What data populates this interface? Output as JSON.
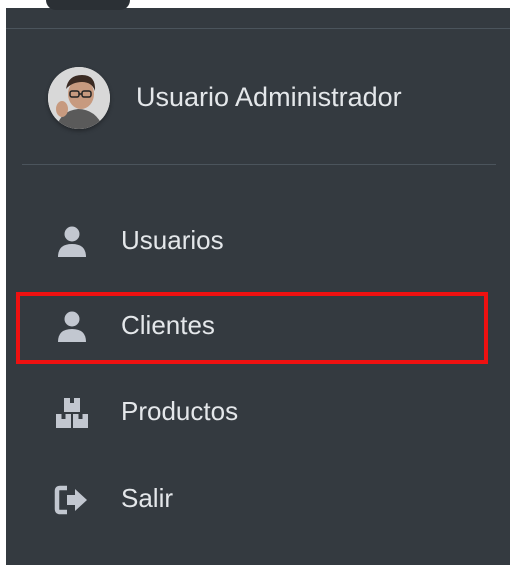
{
  "user": {
    "name": "Usuario Administrador"
  },
  "nav": {
    "items": [
      {
        "label": "Usuarios",
        "icon": "user-icon"
      },
      {
        "label": "Clientes",
        "icon": "user-icon"
      },
      {
        "label": "Productos",
        "icon": "boxes-icon"
      },
      {
        "label": "Salir",
        "icon": "sign-out-icon"
      }
    ]
  },
  "colors": {
    "sidebar_bg": "#343a40",
    "text": "#e4e7ea",
    "icon": "#c2c7d0",
    "divider": "#4b545c",
    "highlight": "#ee1111"
  }
}
